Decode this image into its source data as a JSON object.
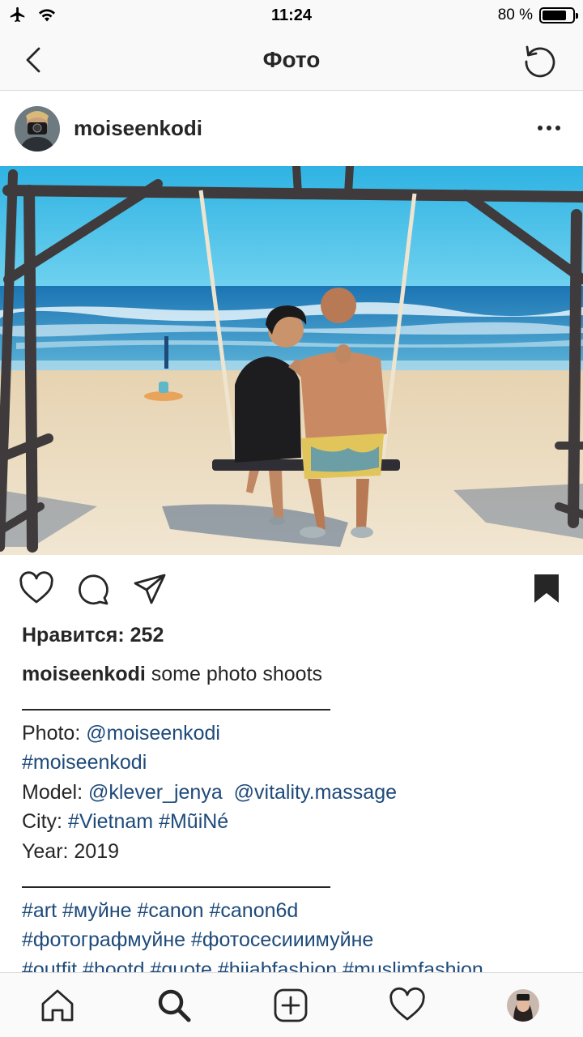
{
  "status_bar": {
    "time": "11:24",
    "battery_text": "80 %",
    "battery_level": 0.8,
    "icons": [
      "airplane-icon",
      "wifi-icon",
      "battery-icon"
    ]
  },
  "nav": {
    "title": "Фото",
    "back_icon": "chevron-left-icon",
    "refresh_icon": "refresh-icon"
  },
  "post": {
    "username": "moiseenkodi",
    "more_icon": "more-horizontal-icon",
    "likes_text": "Нравится: 252",
    "caption": {
      "username": "moiseenkodi",
      "text": " some photo shoots",
      "separator": "________________________",
      "photo_label": "Photo: ",
      "photo_mention": "@moiseenkodi",
      "hashtag_line": "#moiseenkodi",
      "model_label": "Model: ",
      "model_mention1": "@klever_jenya",
      "model_mention2": "@vitality.massage",
      "city_label": "City: ",
      "city_tags": "#Vietnam #MũiNé",
      "year_text": "Year: 2019",
      "tags_line1": "#art #муйне #canon #canon6d",
      "tags_line2": "#фотографмуйне #фотосесииимуйне",
      "tags_line3": "#outfit #hootd #quote #hijabfashion #muslimfashion"
    }
  },
  "actions": {
    "icons": [
      "heart-icon",
      "comment-icon",
      "share-icon",
      "bookmark-icon"
    ]
  },
  "tabbar": {
    "icons": [
      "home-icon",
      "search-icon",
      "add-icon",
      "activity-heart-icon",
      "profile-avatar"
    ]
  },
  "colors": {
    "link": "#1e4a7a",
    "text": "#262626",
    "bar_bg": "#f9f9f9",
    "sky": "#39b6e0",
    "sea": "#2a8fc9",
    "sand": "#e9dcc2"
  }
}
